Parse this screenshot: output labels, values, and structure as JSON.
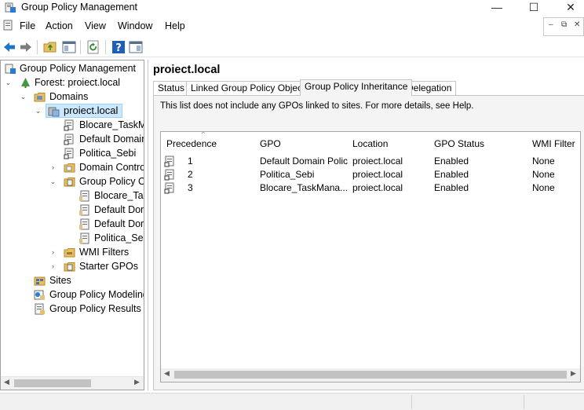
{
  "window": {
    "title": "Group Policy Management",
    "min_glyph": "—",
    "max_glyph": "☐",
    "close_glyph": "✕"
  },
  "menu": {
    "items": [
      "File",
      "Action",
      "View",
      "Window",
      "Help"
    ]
  },
  "mdi": {
    "min": "–",
    "restore": "⧉",
    "close": "✕"
  },
  "toolbar": {
    "icons": [
      "back-arrow-icon",
      "forward-arrow-icon",
      "folder-up-icon",
      "show-hide-console-tree-icon",
      "refresh-icon",
      "help-icon",
      "properties-pane-icon"
    ]
  },
  "tree": {
    "root": "Group Policy Management",
    "forest": "Forest: proiect.local",
    "domains": "Domains",
    "domain": "proiect.local",
    "links": [
      "Blocare_TaskMa",
      "Default Domain",
      "Politica_Sebi"
    ],
    "domain_controllers": "Domain Contro",
    "gpo_container": "Group Policy Ob",
    "gpos": [
      "Blocare_Task",
      "Default Dom",
      "Default Dom",
      "Politica_Seb"
    ],
    "wmi_filters": "WMI Filters",
    "starter_gpos": "Starter GPOs",
    "sites": "Sites",
    "modeling": "Group Policy Modeling",
    "results": "Group Policy Results",
    "expand_open": "⌄",
    "expand_closed": "›"
  },
  "right": {
    "title": "proiect.local",
    "tabs": [
      "Status",
      "Linked Group Policy Objects",
      "Group Policy Inheritance",
      "Delegation"
    ],
    "active_tab": 2,
    "info_text": "This list does not include any GPOs linked to sites. For more details, see Help.",
    "columns": [
      "Precedence",
      "GPO",
      "Location",
      "GPO Status",
      "WMI Filter"
    ],
    "sort_indicator": "^",
    "rows": [
      {
        "precedence": "1",
        "gpo": "Default Domain Policy",
        "location": "proiect.local",
        "status": "Enabled",
        "wmi": "None"
      },
      {
        "precedence": "2",
        "gpo": "Politica_Sebi",
        "location": "proiect.local",
        "status": "Enabled",
        "wmi": "None"
      },
      {
        "precedence": "3",
        "gpo": "Blocare_TaskMana...",
        "location": "proiect.local",
        "status": "Enabled",
        "wmi": "None"
      }
    ]
  },
  "scroll": {
    "left": "◀",
    "right": "▶"
  },
  "colors": {
    "selection": "#cce8ff",
    "toolbar_blue": "#1e74c9",
    "folder": "#e8c062"
  }
}
